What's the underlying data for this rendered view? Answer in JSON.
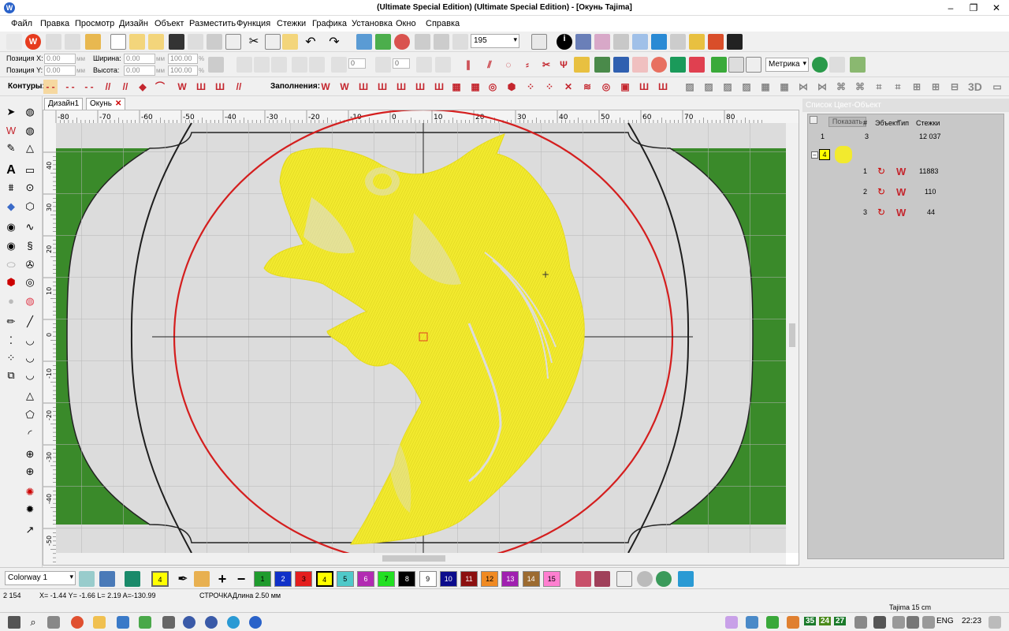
{
  "window": {
    "title": "(Ultimate Special Edition) (Ultimate Special Edition) - [Окунь        Tajima]"
  },
  "menu": [
    "Файл",
    "Правка",
    "Просмотр",
    "Дизайн",
    "Объект",
    "Разместить",
    "Функция",
    "Стежки",
    "Графика",
    "Установка",
    "Окно",
    "Справка"
  ],
  "toolbar": {
    "zoom": "195",
    "units": "Метрика"
  },
  "props": {
    "pos_x_label": "Позиция X:",
    "pos_x": "0.00",
    "pos_y_label": "Позиция Y:",
    "pos_y": "0.00",
    "width_label": "Ширина:",
    "width": "0.00",
    "height_label": "Высота:",
    "height": "0.00",
    "unit_mm": "мм",
    "pct1": "100.00",
    "pct2": "100.00",
    "pct": "%",
    "rot1": "0",
    "rot2": "0"
  },
  "stitchbar": {
    "contours_label": "Контуры:",
    "fills_label": "Заполнения:",
    "view3d": "3D"
  },
  "tabs": [
    {
      "label": "Дизайн1"
    },
    {
      "label": "Окунь"
    }
  ],
  "close_glyph": "✕",
  "ruler": {
    "h_labels": [
      "-80",
      "-70",
      "-60",
      "-50",
      "-40",
      "-30",
      "-20",
      "-10",
      "0",
      "10",
      "20",
      "30",
      "40",
      "50",
      "60",
      "70",
      "80"
    ],
    "v_labels": [
      "40",
      "30",
      "20",
      "10",
      "0",
      "-10",
      "-20",
      "-30",
      "-40",
      "-50"
    ]
  },
  "panel": {
    "title": "Список Цвет-Объект",
    "show_button": "Показать",
    "col_num": "#",
    "col_obj": "Эбъект",
    "col_type": "Тип",
    "col_stitches": "Стежки",
    "summary": {
      "num": "1",
      "count": "3",
      "stitches": "12 037"
    },
    "group_color": "4",
    "rows": [
      {
        "num": "1",
        "stitches": "11883"
      },
      {
        "num": "2",
        "stitches": "110"
      },
      {
        "num": "3",
        "stitches": "44"
      }
    ]
  },
  "colorbar": {
    "colorway": "Colorway 1",
    "current": "4",
    "swatches": [
      {
        "n": "1",
        "c": "#1f9b2d"
      },
      {
        "n": "2",
        "c": "#1030c8"
      },
      {
        "n": "3",
        "c": "#e41e1e"
      },
      {
        "n": "4",
        "c": "#ffff00"
      },
      {
        "n": "5",
        "c": "#4fc9c9"
      },
      {
        "n": "6",
        "c": "#b22bb2"
      },
      {
        "n": "7",
        "c": "#22e022"
      },
      {
        "n": "8",
        "c": "#000000"
      },
      {
        "n": "9",
        "c": "#ffffff"
      },
      {
        "n": "10",
        "c": "#0c0c8c"
      },
      {
        "n": "11",
        "c": "#8c1010"
      },
      {
        "n": "12",
        "c": "#f08a22"
      },
      {
        "n": "13",
        "c": "#a020b0"
      },
      {
        "n": "14",
        "c": "#9c6b30"
      },
      {
        "n": "15",
        "c": "#ff7fd0"
      }
    ]
  },
  "status": {
    "count": "2 154",
    "coords": "X=  -1.44 Y=  -1.66 L=   2.19 A=-130.99",
    "stitch": "СТРОЧКАДлина  2.50 мм",
    "hoop": "Tajima 15 cm"
  },
  "taskbar": {
    "tray_nums": [
      "35",
      "24",
      "27"
    ],
    "lang": "ENG",
    "time": "22:23"
  },
  "colors": {
    "design_yellow": "#f2ea2e",
    "hoop_red": "#d41e1e",
    "green": "#3a8a2a"
  }
}
